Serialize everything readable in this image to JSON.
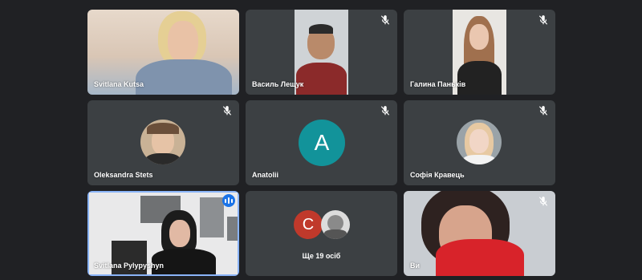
{
  "participants": {
    "p1": {
      "name": "Svitlana Kutsa"
    },
    "p2": {
      "name": "Василь Лещук"
    },
    "p3": {
      "name": "Галина Паньків"
    },
    "p4": {
      "name": "Oleksandra Stets"
    },
    "p5": {
      "name": "Anatolii",
      "initial": "A"
    },
    "p6": {
      "name": "Софія Кравець"
    },
    "p7": {
      "name": "Svitlana Pylypyshyn"
    },
    "p9": {
      "name": "Ви"
    }
  },
  "overflow_tile": {
    "initial": "C",
    "label": "Ще 19 осіб"
  },
  "colors": {
    "background": "#202124",
    "tile": "#3c4043",
    "avatar_a": "#12939a",
    "avatar_c": "#c0392b",
    "speaking": "#1a73e8"
  },
  "icons": {
    "muted": "mic-off-icon",
    "speaking": "audio-level-icon"
  }
}
